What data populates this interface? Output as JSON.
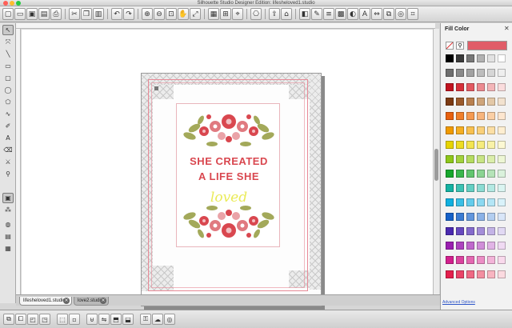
{
  "window": {
    "title": "Silhouette Studio Designer Edition: lifesheloved1.studio",
    "controls": [
      {
        "name": "close",
        "color": "#ff5f57"
      },
      {
        "name": "minimize",
        "color": "#febc2e"
      },
      {
        "name": "zoom",
        "color": "#28c840"
      }
    ]
  },
  "toolbar": {
    "buttons": [
      {
        "name": "new-document-icon",
        "glyph": "▢"
      },
      {
        "name": "open-folder-icon",
        "glyph": "▭"
      },
      {
        "name": "save-icon",
        "glyph": "▣"
      },
      {
        "name": "library-icon",
        "glyph": "▤"
      },
      {
        "name": "print-icon",
        "glyph": "⎙"
      },
      {
        "name": "cut-icon",
        "glyph": "✂"
      },
      {
        "name": "copy-icon",
        "glyph": "❐"
      },
      {
        "name": "paste-icon",
        "glyph": "▥"
      },
      {
        "name": "undo-icon",
        "glyph": "↶"
      },
      {
        "name": "redo-icon",
        "glyph": "↷"
      },
      {
        "name": "zoom-in-icon",
        "glyph": "⊕"
      },
      {
        "name": "zoom-out-icon",
        "glyph": "⊖"
      },
      {
        "name": "zoom-select-icon",
        "glyph": "⊡"
      },
      {
        "name": "pan-icon",
        "glyph": "✋"
      },
      {
        "name": "zoom-fit-icon",
        "glyph": "⤢"
      },
      {
        "name": "page-setup-icon",
        "glyph": "▦"
      },
      {
        "name": "grid-icon",
        "glyph": "⊞"
      },
      {
        "name": "registration-icon",
        "glyph": "⌖"
      },
      {
        "name": "cut-settings-icon",
        "glyph": "⎔"
      },
      {
        "name": "send-to-silhouette-icon",
        "glyph": "⇪"
      },
      {
        "name": "store-icon",
        "glyph": "⌂"
      },
      {
        "name": "fill-color-icon",
        "glyph": "◧"
      },
      {
        "name": "line-color-icon",
        "glyph": "✎"
      },
      {
        "name": "line-style-icon",
        "glyph": "≡"
      },
      {
        "name": "fill-pattern-icon",
        "glyph": "▩"
      },
      {
        "name": "transparency-icon",
        "glyph": "◐"
      },
      {
        "name": "text-style-icon",
        "glyph": "A"
      },
      {
        "name": "align-icon",
        "glyph": "⇔"
      },
      {
        "name": "replicate-icon",
        "glyph": "⧉"
      },
      {
        "name": "offset-icon",
        "glyph": "◎"
      },
      {
        "name": "trace-icon",
        "glyph": "⌗"
      }
    ]
  },
  "left_tools": [
    {
      "name": "select-tool-icon",
      "glyph": "↖",
      "active": true
    },
    {
      "name": "edit-points-tool-icon",
      "glyph": "⤧",
      "active": false
    },
    {
      "name": "line-tool-icon",
      "glyph": "╲",
      "active": false
    },
    {
      "name": "rectangle-tool-icon",
      "glyph": "▭",
      "active": false
    },
    {
      "name": "rounded-rectangle-tool-icon",
      "glyph": "▢",
      "active": false
    },
    {
      "name": "ellipse-tool-icon",
      "glyph": "◯",
      "active": false
    },
    {
      "name": "polygon-tool-icon",
      "glyph": "⬠",
      "active": false
    },
    {
      "name": "curve-tool-icon",
      "glyph": "∿",
      "active": false
    },
    {
      "name": "freehand-tool-icon",
      "glyph": "✐",
      "active": false
    },
    {
      "name": "text-tool-icon",
      "glyph": "A",
      "active": false
    },
    {
      "name": "eraser-tool-icon",
      "glyph": "⌫",
      "active": false
    },
    {
      "name": "knife-tool-icon",
      "glyph": "⚔",
      "active": false
    },
    {
      "name": "eyedropper-tool-icon",
      "glyph": "⚲",
      "active": false
    },
    {
      "name": "show-cut-lines-icon",
      "glyph": "▣",
      "active": true
    },
    {
      "name": "rhinestone-icon",
      "glyph": "⁂",
      "active": false
    },
    {
      "name": "sketch-icon",
      "glyph": "◍",
      "active": false
    },
    {
      "name": "design-store-icon",
      "glyph": "▤",
      "active": false
    },
    {
      "name": "library-panel-icon",
      "glyph": "▦",
      "active": false
    }
  ],
  "design": {
    "line1": "SHE CREATED",
    "line2": "A LIFE SHE",
    "script": "loved",
    "accent_red": "#d9474f",
    "accent_yellow": "#eaeb58",
    "leaf_green": "#a3a95a"
  },
  "fill_panel": {
    "title": "Fill Color",
    "close_glyph": "✕",
    "current_color": "#e05d68",
    "advanced_label": "Advanced Options",
    "swatch_rows": [
      [
        "#000000",
        "#3a3a3a",
        "#777777",
        "#b2b2b2",
        "#e2e2e2",
        "#ffffff"
      ],
      [
        "#6e6e6e",
        "#8a8a8a",
        "#a2a2a2",
        "#bdbdbd",
        "#d6d6d6",
        "#eeeeee"
      ],
      [
        "#c1121f",
        "#d6303a",
        "#e35a62",
        "#ec8a90",
        "#f3b5b8",
        "#fadcdd"
      ],
      [
        "#7c3a12",
        "#9b5a2b",
        "#b9804f",
        "#cfa57a",
        "#e3c8a7",
        "#f2e2cf"
      ],
      [
        "#e7600e",
        "#f07f2a",
        "#f59a51",
        "#f8b57c",
        "#fbcfa5",
        "#fde6cf"
      ],
      [
        "#f09a00",
        "#f5ae22",
        "#f8c04f",
        "#fad07a",
        "#fcdfa5",
        "#feeed1"
      ],
      [
        "#e7d400",
        "#eedd22",
        "#f3e551",
        "#f6ec7d",
        "#f9f2a8",
        "#fcf8d3"
      ],
      [
        "#8ec71a",
        "#a2d23c",
        "#b5dc60",
        "#c8e585",
        "#dbeeab",
        "#edf6d5"
      ],
      [
        "#16a72c",
        "#3ab74d",
        "#62c56f",
        "#8cd493",
        "#b5e3b8",
        "#daf1dc"
      ],
      [
        "#14b2a2",
        "#3cc2b3",
        "#64cfc3",
        "#8cdcd3",
        "#b4e9e3",
        "#daf4f1"
      ],
      [
        "#0fb0e0",
        "#3abfe6",
        "#64ccec",
        "#8cd9f1",
        "#b4e6f6",
        "#d9f2fa"
      ],
      [
        "#1560c8",
        "#3a7bd3",
        "#6296dd",
        "#8bb2e7",
        "#b3cef0",
        "#d9e6f8"
      ],
      [
        "#4a29b0",
        "#6749bf",
        "#856bcc",
        "#a48ed9",
        "#c3b3e6",
        "#e1d9f3"
      ],
      [
        "#9a1fb0",
        "#ad43bf",
        "#bf68cc",
        "#d08ed9",
        "#e1b4e6",
        "#f0daf3"
      ],
      [
        "#d21f8d",
        "#db439f",
        "#e468b2",
        "#ec8ec6",
        "#f3b4d9",
        "#f9d9ec"
      ],
      [
        "#e41f4d",
        "#ea4368",
        "#ef6984",
        "#f38fa1",
        "#f8b5c1",
        "#fbdae0"
      ]
    ]
  },
  "tabs": [
    {
      "label": "lifesheloved1.studio",
      "active": true
    },
    {
      "label": "love2.studio",
      "active": false
    }
  ],
  "bottom_toolbar": [
    {
      "name": "group-icon",
      "glyph": "⧉"
    },
    {
      "name": "ungroup-icon",
      "glyph": "⧠"
    },
    {
      "name": "compound-path-icon",
      "glyph": "◰"
    },
    {
      "name": "release-compound-icon",
      "glyph": "◳"
    },
    {
      "name": "select-all-icon",
      "glyph": "⬚"
    },
    {
      "name": "deselect-icon",
      "glyph": "▫"
    },
    {
      "name": "weld-icon",
      "glyph": "⊎"
    },
    {
      "name": "flip-icon",
      "glyph": "⇋"
    },
    {
      "name": "bring-forward-icon",
      "glyph": "⬒"
    },
    {
      "name": "send-back-icon",
      "glyph": "⬓"
    },
    {
      "name": "lock-icon",
      "glyph": "⚿"
    },
    {
      "name": "cloud-icon",
      "glyph": "☁"
    },
    {
      "name": "target-icon",
      "glyph": "◎"
    }
  ]
}
